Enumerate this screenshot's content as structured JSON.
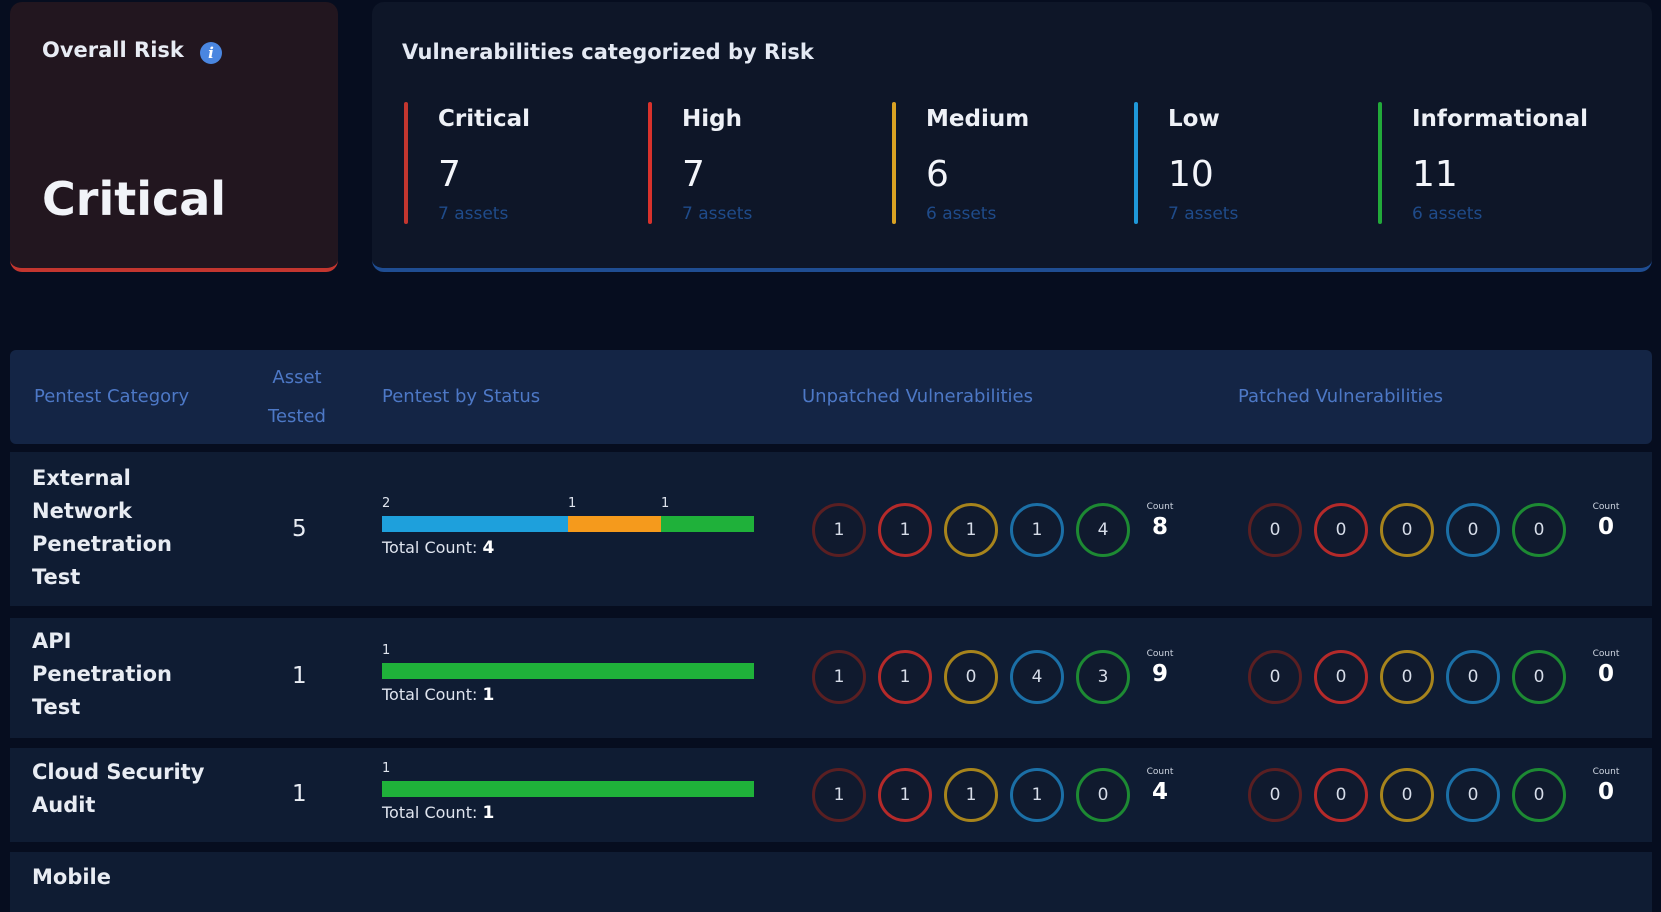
{
  "overall": {
    "title": "Overall Risk",
    "value": "Critical"
  },
  "vulnerabilities": {
    "title": "Vulnerabilities categorized by Risk",
    "categories": [
      {
        "label": "Critical",
        "count": "7",
        "assets": "7 assets",
        "color": "#c3362f"
      },
      {
        "label": "High",
        "count": "7",
        "assets": "7 assets",
        "color": "#d8322c"
      },
      {
        "label": "Medium",
        "count": "6",
        "assets": "6 assets",
        "color": "#d9a223"
      },
      {
        "label": "Low",
        "count": "10",
        "assets": "7 assets",
        "color": "#1f98d9"
      },
      {
        "label": "Informational",
        "count": "11",
        "assets": "6 assets",
        "color": "#22a93a"
      }
    ]
  },
  "table": {
    "headers": {
      "category": "Pentest Category",
      "asset_line1": "Asset",
      "asset_line2": "Tested",
      "status": "Pentest by Status",
      "unpatched": "Unpatched Vulnerabilities",
      "patched": "Patched Vulnerabilities"
    },
    "count_label": "Count",
    "total_label": "Total Count:",
    "rows": [
      {
        "category_lines": [
          "External",
          "Network",
          "Penetration",
          "Test"
        ],
        "assets": "5",
        "status_segments": [
          {
            "value": 2,
            "label": "2",
            "color": "#1ea0dc"
          },
          {
            "value": 1,
            "label": "1",
            "color": "#f59a1c"
          },
          {
            "value": 1,
            "label": "1",
            "color": "#1fb13a"
          }
        ],
        "total": "4",
        "unpatched": [
          "1",
          "1",
          "1",
          "1",
          "4"
        ],
        "unpatched_count": "8",
        "patched": [
          "0",
          "0",
          "0",
          "0",
          "0"
        ],
        "patched_count": "0"
      },
      {
        "category_lines": [
          "API",
          "Penetration",
          "Test"
        ],
        "assets": "1",
        "status_segments": [
          {
            "value": 1,
            "label": "1",
            "color": "#1fb13a"
          }
        ],
        "total": "1",
        "unpatched": [
          "1",
          "1",
          "0",
          "4",
          "3"
        ],
        "unpatched_count": "9",
        "patched": [
          "0",
          "0",
          "0",
          "0",
          "0"
        ],
        "patched_count": "0"
      },
      {
        "category_lines": [
          "Cloud Security",
          "Audit"
        ],
        "assets": "1",
        "status_segments": [
          {
            "value": 1,
            "label": "1",
            "color": "#1fb13a"
          }
        ],
        "total": "1",
        "unpatched": [
          "1",
          "1",
          "1",
          "1",
          "0"
        ],
        "unpatched_count": "4",
        "patched": [
          "0",
          "0",
          "0",
          "0",
          "0"
        ],
        "patched_count": "0"
      },
      {
        "category_lines": [
          "Mobile"
        ]
      }
    ]
  },
  "circle_colors": [
    "#5a1f22",
    "#b52a2a",
    "#a7841c",
    "#1b6fa6",
    "#1d8a33"
  ]
}
